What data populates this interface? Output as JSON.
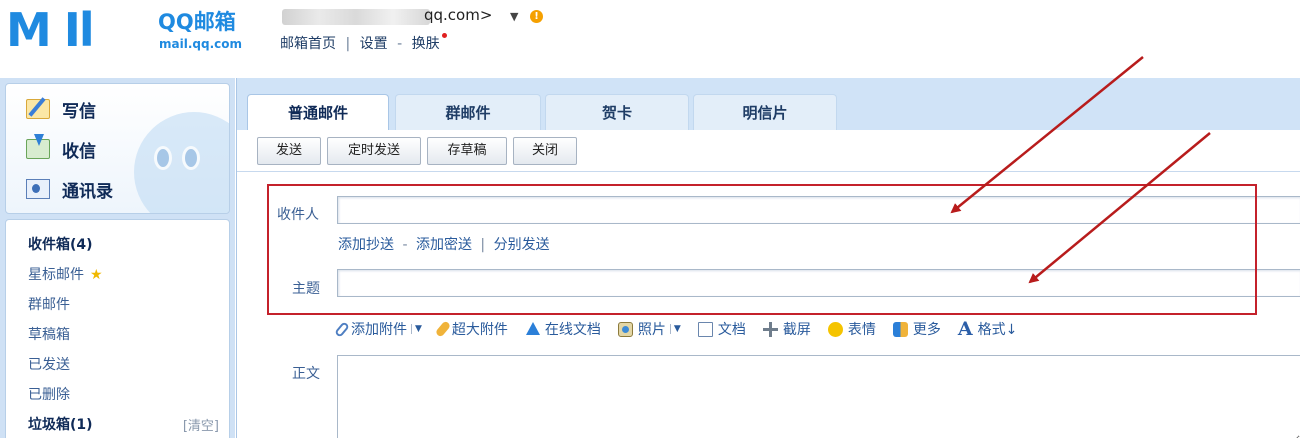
{
  "header": {
    "logo_word": "M Il",
    "logo_cn": "QQ邮箱",
    "logo_domain": "mail.qq.com",
    "account_email": "qq.com>",
    "account_caret": "▼",
    "account_warn": "!",
    "links": [
      "邮箱首页",
      "设置",
      "换肤"
    ],
    "link_sep_1": "|",
    "link_sep_2": "-"
  },
  "sidebar": {
    "quick": [
      {
        "label": "写信",
        "icon": "write-icon"
      },
      {
        "label": "收信",
        "icon": "inbox-icon"
      },
      {
        "label": "通讯录",
        "icon": "contacts-icon"
      }
    ],
    "folders": [
      {
        "label": "收件箱(4)",
        "bold": true
      },
      {
        "label": "星标邮件",
        "bold": false,
        "star": "★"
      },
      {
        "label": "群邮件",
        "bold": false
      },
      {
        "label": "草稿箱",
        "bold": false
      },
      {
        "label": "已发送",
        "bold": false
      },
      {
        "label": "已删除",
        "bold": false
      },
      {
        "label": "垃圾箱(1)",
        "bold": true,
        "action": "[清空]"
      }
    ]
  },
  "tabs": [
    "普通邮件",
    "群邮件",
    "贺卡",
    "明信片"
  ],
  "toolbar": {
    "send": "发送",
    "scheduled_send": "定时发送",
    "save_draft": "存草稿",
    "close": "关闭"
  },
  "compose": {
    "recipient_label": "收件人",
    "recipient_value": "",
    "cc_links": [
      "添加抄送",
      "添加密送",
      "分别发送"
    ],
    "cc_sep_1": "-",
    "cc_sep_2": "|",
    "subject_label": "主题",
    "subject_value": "",
    "body_label": "正文",
    "body_value": ""
  },
  "format_bar": [
    {
      "label": "添加附件",
      "icon": "attachment-icon",
      "dropdown": true
    },
    {
      "label": "超大附件",
      "icon": "large-attachment-icon",
      "dropdown": false
    },
    {
      "label": "在线文档",
      "icon": "online-doc-icon",
      "dropdown": false
    },
    {
      "label": "照片",
      "icon": "photo-icon",
      "dropdown": true
    },
    {
      "label": "文档",
      "icon": "doc-icon",
      "dropdown": false
    },
    {
      "label": "截屏",
      "icon": "screenshot-icon",
      "dropdown": false
    },
    {
      "label": "表情",
      "icon": "emoji-icon",
      "dropdown": false
    },
    {
      "label": "更多",
      "icon": "more-icon",
      "dropdown": false
    },
    {
      "label": "格式↓",
      "icon": "format-icon",
      "icon_glyph": "A",
      "dropdown": false
    }
  ],
  "colors": {
    "accent": "#1f8ae0",
    "highlight_box": "#c4212b",
    "annotation_arrow": "#b81c1c",
    "sidebar_bg": "#cfe1f5"
  }
}
